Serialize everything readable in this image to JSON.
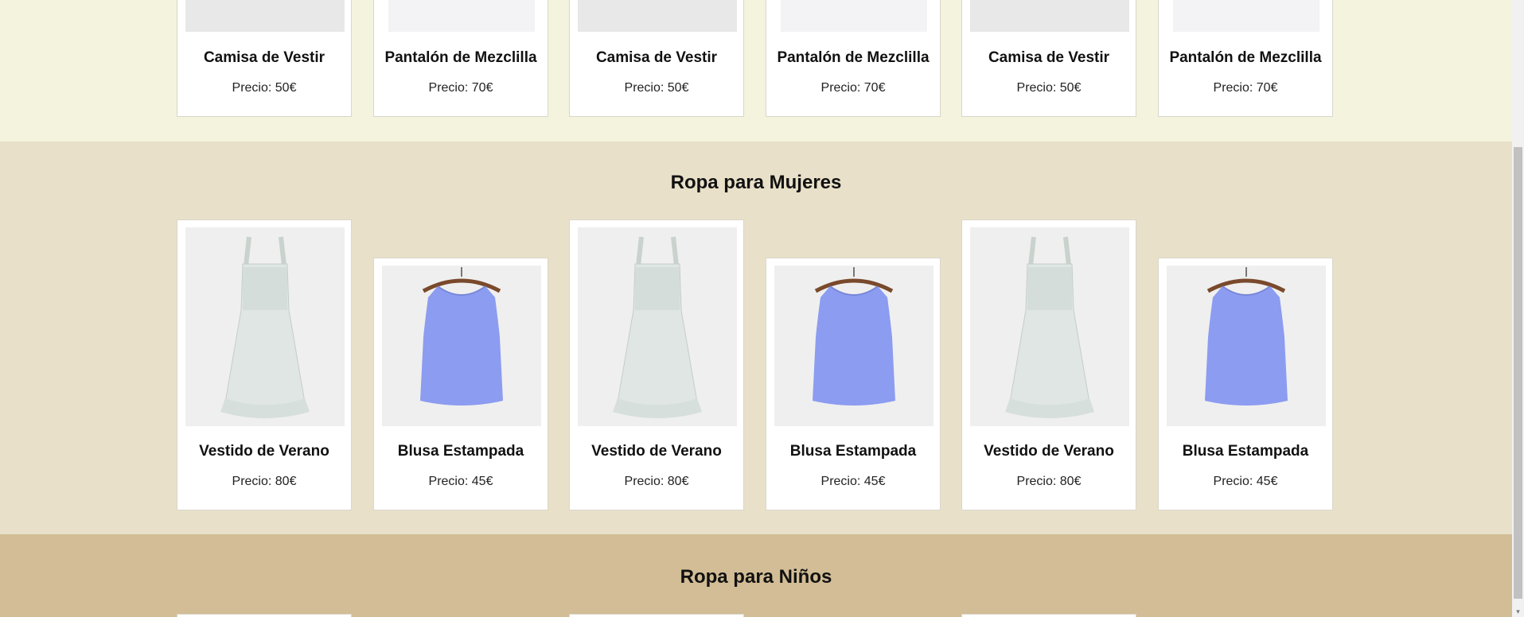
{
  "men": {
    "products": [
      {
        "name": "Camisa de Vestir",
        "price": "Precio: 50€"
      },
      {
        "name": "Pantalón de Mezclilla",
        "price": "Precio: 70€"
      },
      {
        "name": "Camisa de Vestir",
        "price": "Precio: 50€"
      },
      {
        "name": "Pantalón de Mezclilla",
        "price": "Precio: 70€"
      },
      {
        "name": "Camisa de Vestir",
        "price": "Precio: 50€"
      },
      {
        "name": "Pantalón de Mezclilla",
        "price": "Precio: 70€"
      }
    ]
  },
  "women": {
    "title": "Ropa para Mujeres",
    "products": [
      {
        "name": "Vestido de Verano",
        "price": "Precio: 80€",
        "image": "summer-dress-image"
      },
      {
        "name": "Blusa Estampada",
        "price": "Precio: 45€",
        "image": "blouse-image"
      },
      {
        "name": "Vestido de Verano",
        "price": "Precio: 80€",
        "image": "summer-dress-image"
      },
      {
        "name": "Blusa Estampada",
        "price": "Precio: 45€",
        "image": "blouse-image"
      },
      {
        "name": "Vestido de Verano",
        "price": "Precio: 80€",
        "image": "summer-dress-image"
      },
      {
        "name": "Blusa Estampada",
        "price": "Precio: 45€",
        "image": "blouse-image"
      }
    ]
  },
  "kids": {
    "title": "Ropa para Niños"
  },
  "colors": {
    "men_bg": "#f4f3de",
    "women_bg": "#e8e0c8",
    "kids_bg": "#d2bd96",
    "blouse": "#8c9cf0"
  }
}
